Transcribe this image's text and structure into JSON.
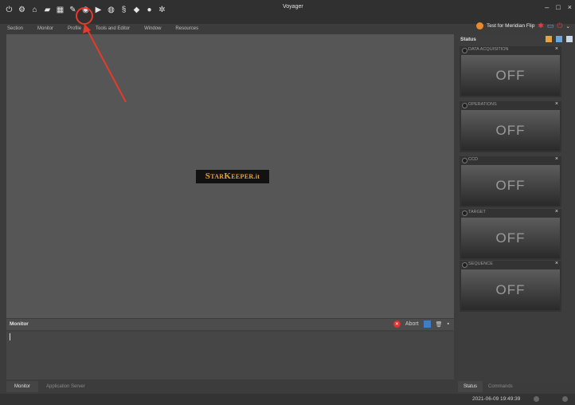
{
  "window": {
    "title": "Voyager"
  },
  "toolbar": {
    "icons": [
      "power-icon",
      "gear-icon",
      "home-icon",
      "folder-icon",
      "map-icon",
      "tools-icon",
      "eye-icon",
      "play-icon",
      "globe-icon",
      "script-icon",
      "flag-icon",
      "circle-icon",
      "network-icon"
    ]
  },
  "menu": {
    "items": [
      "Section",
      "Monitor",
      "Profile",
      "Tools and Editor",
      "Window",
      "Resources"
    ]
  },
  "header_right": {
    "test_label": "Test for Meridian Flip"
  },
  "logo": {
    "part1": "S",
    "part2": "TAR",
    "part3": "K",
    "part4": "EEPER",
    "part5": ".it"
  },
  "monitor": {
    "title": "Monitor",
    "abort_label": "Abort",
    "tabs": [
      "Monitor",
      "Application Server"
    ]
  },
  "status": {
    "title": "Status",
    "cards": [
      {
        "label": "DATA ACQUISITION",
        "value": "OFF"
      },
      {
        "label": "OPERATIONS",
        "value": "OFF"
      },
      {
        "label": "CCD",
        "value": "OFF"
      },
      {
        "label": "TARGET",
        "value": "OFF"
      },
      {
        "label": "SEQUENCE",
        "value": "OFF"
      }
    ],
    "tabs": [
      "Status",
      "Commands"
    ]
  },
  "statusbar": {
    "datetime": "2021-06-09   19:49:39"
  },
  "colors": {
    "accent": "#e9a23b",
    "annotation": "#e8392a"
  }
}
